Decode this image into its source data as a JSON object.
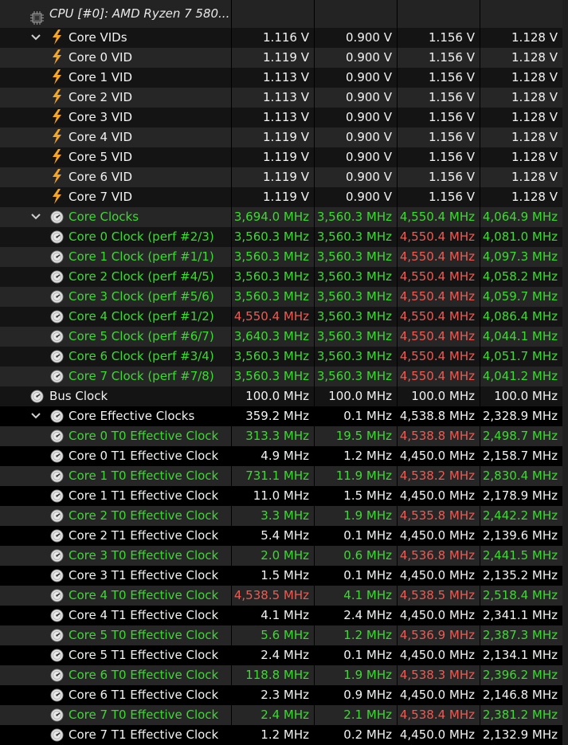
{
  "header": {
    "title": "CPU [#0]: AMD Ryzen 7 580...",
    "icon": "cpu-chip-icon"
  },
  "rows": [
    {
      "label": "Core VIDs",
      "values": [
        "1.116 V",
        "0.900 V",
        "1.156 V",
        "1.128 V"
      ],
      "colors": [
        "white",
        "white",
        "white",
        "white"
      ],
      "label_color": "white",
      "icon": "voltage-bolt-icon",
      "group": true,
      "bg": "dark"
    },
    {
      "label": "Core 0 VID",
      "values": [
        "1.119 V",
        "0.900 V",
        "1.156 V",
        "1.128 V"
      ],
      "colors": [
        "white",
        "white",
        "white",
        "white"
      ],
      "label_color": "white",
      "icon": "voltage-bolt-icon",
      "bg": "light"
    },
    {
      "label": "Core 1 VID",
      "values": [
        "1.113 V",
        "0.900 V",
        "1.156 V",
        "1.128 V"
      ],
      "colors": [
        "white",
        "white",
        "white",
        "white"
      ],
      "label_color": "white",
      "icon": "voltage-bolt-icon",
      "bg": "dark"
    },
    {
      "label": "Core 2 VID",
      "values": [
        "1.113 V",
        "0.900 V",
        "1.156 V",
        "1.128 V"
      ],
      "colors": [
        "white",
        "white",
        "white",
        "white"
      ],
      "label_color": "white",
      "icon": "voltage-bolt-icon",
      "bg": "light"
    },
    {
      "label": "Core 3 VID",
      "values": [
        "1.113 V",
        "0.900 V",
        "1.156 V",
        "1.128 V"
      ],
      "colors": [
        "white",
        "white",
        "white",
        "white"
      ],
      "label_color": "white",
      "icon": "voltage-bolt-icon",
      "bg": "dark"
    },
    {
      "label": "Core 4 VID",
      "values": [
        "1.119 V",
        "0.900 V",
        "1.156 V",
        "1.128 V"
      ],
      "colors": [
        "white",
        "white",
        "white",
        "white"
      ],
      "label_color": "white",
      "icon": "voltage-bolt-icon",
      "bg": "light"
    },
    {
      "label": "Core 5 VID",
      "values": [
        "1.119 V",
        "0.900 V",
        "1.156 V",
        "1.128 V"
      ],
      "colors": [
        "white",
        "white",
        "white",
        "white"
      ],
      "label_color": "white",
      "icon": "voltage-bolt-icon",
      "bg": "dark"
    },
    {
      "label": "Core 6 VID",
      "values": [
        "1.119 V",
        "0.900 V",
        "1.156 V",
        "1.128 V"
      ],
      "colors": [
        "white",
        "white",
        "white",
        "white"
      ],
      "label_color": "white",
      "icon": "voltage-bolt-icon",
      "bg": "light"
    },
    {
      "label": "Core 7 VID",
      "values": [
        "1.119 V",
        "0.900 V",
        "1.156 V",
        "1.128 V"
      ],
      "colors": [
        "white",
        "white",
        "white",
        "white"
      ],
      "label_color": "white",
      "icon": "voltage-bolt-icon",
      "bg": "dark"
    },
    {
      "label": "Core Clocks",
      "values": [
        "3,694.0 MHz",
        "3,560.3 MHz",
        "4,550.4 MHz",
        "4,064.9 MHz"
      ],
      "colors": [
        "green",
        "green",
        "green",
        "green"
      ],
      "label_color": "green",
      "icon": "clock-gauge-icon",
      "group": true,
      "bg": "light"
    },
    {
      "label": "Core 0 Clock (perf #2/3)",
      "values": [
        "3,560.3 MHz",
        "3,560.3 MHz",
        "4,550.4 MHz",
        "4,081.0 MHz"
      ],
      "colors": [
        "green",
        "green",
        "red",
        "green"
      ],
      "label_color": "green",
      "icon": "clock-gauge-icon",
      "bg": "dark"
    },
    {
      "label": "Core 1 Clock (perf #1/1)",
      "values": [
        "3,560.3 MHz",
        "3,560.3 MHz",
        "4,550.4 MHz",
        "4,097.3 MHz"
      ],
      "colors": [
        "green",
        "green",
        "red",
        "green"
      ],
      "label_color": "green",
      "icon": "clock-gauge-icon",
      "bg": "light"
    },
    {
      "label": "Core 2 Clock (perf #4/5)",
      "values": [
        "3,560.3 MHz",
        "3,560.3 MHz",
        "4,550.4 MHz",
        "4,058.2 MHz"
      ],
      "colors": [
        "green",
        "green",
        "red",
        "green"
      ],
      "label_color": "green",
      "icon": "clock-gauge-icon",
      "bg": "dark"
    },
    {
      "label": "Core 3 Clock (perf #5/6)",
      "values": [
        "3,560.3 MHz",
        "3,560.3 MHz",
        "4,550.4 MHz",
        "4,059.7 MHz"
      ],
      "colors": [
        "green",
        "green",
        "red",
        "green"
      ],
      "label_color": "green",
      "icon": "clock-gauge-icon",
      "bg": "light"
    },
    {
      "label": "Core 4 Clock (perf #1/2)",
      "values": [
        "4,550.4 MHz",
        "3,560.3 MHz",
        "4,550.4 MHz",
        "4,086.4 MHz"
      ],
      "colors": [
        "red",
        "green",
        "red",
        "green"
      ],
      "label_color": "green",
      "icon": "clock-gauge-icon",
      "bg": "dark"
    },
    {
      "label": "Core 5 Clock (perf #6/7)",
      "values": [
        "3,640.3 MHz",
        "3,560.3 MHz",
        "4,550.4 MHz",
        "4,044.1 MHz"
      ],
      "colors": [
        "green",
        "green",
        "red",
        "green"
      ],
      "label_color": "green",
      "icon": "clock-gauge-icon",
      "bg": "light"
    },
    {
      "label": "Core 6 Clock (perf #3/4)",
      "values": [
        "3,560.3 MHz",
        "3,560.3 MHz",
        "4,550.4 MHz",
        "4,051.7 MHz"
      ],
      "colors": [
        "green",
        "green",
        "red",
        "green"
      ],
      "label_color": "green",
      "icon": "clock-gauge-icon",
      "bg": "dark"
    },
    {
      "label": "Core 7 Clock (perf #7/8)",
      "values": [
        "3,560.3 MHz",
        "3,560.3 MHz",
        "4,550.4 MHz",
        "4,041.2 MHz"
      ],
      "colors": [
        "green",
        "green",
        "red",
        "green"
      ],
      "label_color": "green",
      "icon": "clock-gauge-icon",
      "bg": "light"
    },
    {
      "label": "Bus Clock",
      "values": [
        "100.0 MHz",
        "100.0 MHz",
        "100.0 MHz",
        "100.0 MHz"
      ],
      "colors": [
        "white",
        "white",
        "white",
        "white"
      ],
      "label_color": "white",
      "icon": "clock-gauge-icon",
      "top_level": true,
      "bg": "dark"
    },
    {
      "label": "Core Effective Clocks",
      "values": [
        "359.2 MHz",
        "0.1 MHz",
        "4,538.8 MHz",
        "2,328.9 MHz"
      ],
      "colors": [
        "white",
        "white",
        "white",
        "white"
      ],
      "label_color": "white",
      "icon": "clock-gauge-icon",
      "group": true,
      "bg": "black"
    },
    {
      "label": "Core 0 T0 Effective Clock",
      "values": [
        "313.3 MHz",
        "19.5 MHz",
        "4,538.8 MHz",
        "2,498.7 MHz"
      ],
      "colors": [
        "green",
        "green",
        "red",
        "green"
      ],
      "label_color": "green",
      "icon": "clock-gauge-icon",
      "bg": "light"
    },
    {
      "label": "Core 0 T1 Effective Clock",
      "values": [
        "4.9 MHz",
        "1.2 MHz",
        "4,450.0 MHz",
        "2,158.7 MHz"
      ],
      "colors": [
        "white",
        "white",
        "white",
        "white"
      ],
      "label_color": "white",
      "icon": "clock-gauge-icon",
      "bg": "black"
    },
    {
      "label": "Core 1 T0 Effective Clock",
      "values": [
        "731.1 MHz",
        "11.9 MHz",
        "4,538.2 MHz",
        "2,830.4 MHz"
      ],
      "colors": [
        "green",
        "green",
        "red",
        "green"
      ],
      "label_color": "green",
      "icon": "clock-gauge-icon",
      "bg": "light"
    },
    {
      "label": "Core 1 T1 Effective Clock",
      "values": [
        "11.0 MHz",
        "1.5 MHz",
        "4,450.0 MHz",
        "2,178.9 MHz"
      ],
      "colors": [
        "white",
        "white",
        "white",
        "white"
      ],
      "label_color": "white",
      "icon": "clock-gauge-icon",
      "bg": "black"
    },
    {
      "label": "Core 2 T0 Effective Clock",
      "values": [
        "3.3 MHz",
        "1.9 MHz",
        "4,535.8 MHz",
        "2,442.2 MHz"
      ],
      "colors": [
        "green",
        "green",
        "red",
        "green"
      ],
      "label_color": "green",
      "icon": "clock-gauge-icon",
      "bg": "light"
    },
    {
      "label": "Core 2 T1 Effective Clock",
      "values": [
        "5.4 MHz",
        "0.1 MHz",
        "4,450.0 MHz",
        "2,139.6 MHz"
      ],
      "colors": [
        "white",
        "white",
        "white",
        "white"
      ],
      "label_color": "white",
      "icon": "clock-gauge-icon",
      "bg": "black"
    },
    {
      "label": "Core 3 T0 Effective Clock",
      "values": [
        "2.0 MHz",
        "0.6 MHz",
        "4,536.8 MHz",
        "2,441.5 MHz"
      ],
      "colors": [
        "green",
        "green",
        "red",
        "green"
      ],
      "label_color": "green",
      "icon": "clock-gauge-icon",
      "bg": "light"
    },
    {
      "label": "Core 3 T1 Effective Clock",
      "values": [
        "1.5 MHz",
        "0.1 MHz",
        "4,450.0 MHz",
        "2,135.2 MHz"
      ],
      "colors": [
        "white",
        "white",
        "white",
        "white"
      ],
      "label_color": "white",
      "icon": "clock-gauge-icon",
      "bg": "black"
    },
    {
      "label": "Core 4 T0 Effective Clock",
      "values": [
        "4,538.5 MHz",
        "4.1 MHz",
        "4,538.5 MHz",
        "2,518.4 MHz"
      ],
      "colors": [
        "red",
        "green",
        "red",
        "green"
      ],
      "label_color": "green",
      "icon": "clock-gauge-icon",
      "bg": "light"
    },
    {
      "label": "Core 4 T1 Effective Clock",
      "values": [
        "4.1 MHz",
        "2.4 MHz",
        "4,450.0 MHz",
        "2,341.1 MHz"
      ],
      "colors": [
        "white",
        "white",
        "white",
        "white"
      ],
      "label_color": "white",
      "icon": "clock-gauge-icon",
      "bg": "black"
    },
    {
      "label": "Core 5 T0 Effective Clock",
      "values": [
        "5.6 MHz",
        "1.2 MHz",
        "4,536.9 MHz",
        "2,387.3 MHz"
      ],
      "colors": [
        "green",
        "green",
        "red",
        "green"
      ],
      "label_color": "green",
      "icon": "clock-gauge-icon",
      "bg": "light"
    },
    {
      "label": "Core 5 T1 Effective Clock",
      "values": [
        "2.4 MHz",
        "0.1 MHz",
        "4,450.0 MHz",
        "2,134.1 MHz"
      ],
      "colors": [
        "white",
        "white",
        "white",
        "white"
      ],
      "label_color": "white",
      "icon": "clock-gauge-icon",
      "bg": "black"
    },
    {
      "label": "Core 6 T0 Effective Clock",
      "values": [
        "118.8 MHz",
        "1.9 MHz",
        "4,538.3 MHz",
        "2,396.2 MHz"
      ],
      "colors": [
        "green",
        "green",
        "red",
        "green"
      ],
      "label_color": "green",
      "icon": "clock-gauge-icon",
      "bg": "light"
    },
    {
      "label": "Core 6 T1 Effective Clock",
      "values": [
        "2.3 MHz",
        "0.9 MHz",
        "4,450.0 MHz",
        "2,146.8 MHz"
      ],
      "colors": [
        "white",
        "white",
        "white",
        "white"
      ],
      "label_color": "white",
      "icon": "clock-gauge-icon",
      "bg": "black"
    },
    {
      "label": "Core 7 T0 Effective Clock",
      "values": [
        "2.4 MHz",
        "2.1 MHz",
        "4,538.4 MHz",
        "2,381.2 MHz"
      ],
      "colors": [
        "green",
        "green",
        "red",
        "green"
      ],
      "label_color": "green",
      "icon": "clock-gauge-icon",
      "bg": "light"
    },
    {
      "label": "Core 7 T1 Effective Clock",
      "values": [
        "1.2 MHz",
        "0.2 MHz",
        "4,450.0 MHz",
        "2,132.9 MHz"
      ],
      "colors": [
        "white",
        "white",
        "white",
        "white"
      ],
      "label_color": "white",
      "icon": "clock-gauge-icon",
      "bg": "black"
    }
  ],
  "colors": {
    "green": "#38dd2c",
    "red": "#f05a52",
    "white": "#f2f2f2",
    "bolt": "#f5a623"
  }
}
